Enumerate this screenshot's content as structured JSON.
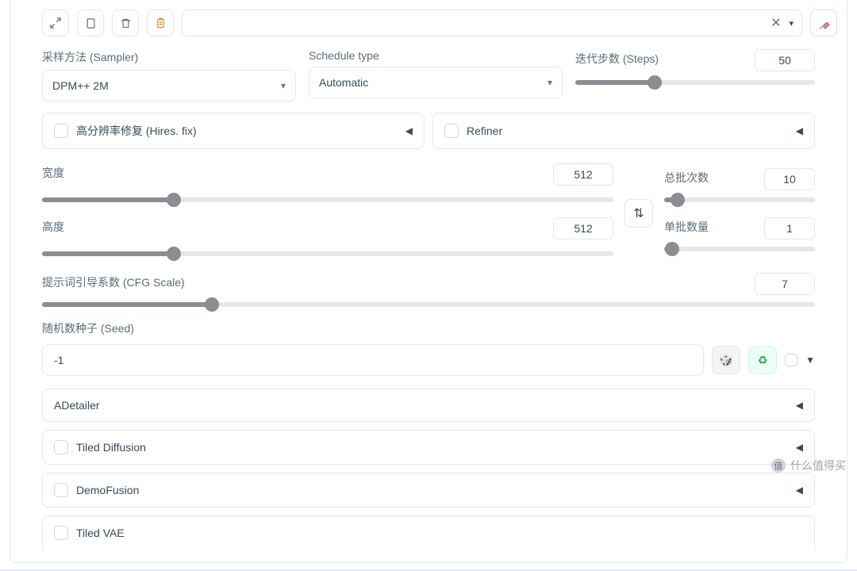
{
  "toolbar": {
    "icons": {
      "expand": "expand-icon",
      "copy": "copy-icon",
      "trash": "trash-icon",
      "clipboard": "clipboard-icon",
      "brush": "brush-icon"
    },
    "close_x": "✕",
    "caret": "▾"
  },
  "sampler": {
    "label": "采样方法 (Sampler)",
    "value": "DPM++ 2M"
  },
  "schedule": {
    "label": "Schedule type",
    "value": "Automatic"
  },
  "steps": {
    "label": "迭代步数 (Steps)",
    "value": "50",
    "fill_pct": 33
  },
  "hires": {
    "label": "高分辨率修复 (Hires. fix)"
  },
  "refiner": {
    "label": "Refiner"
  },
  "width": {
    "label": "宽度",
    "value": "512",
    "fill_pct": 23
  },
  "height": {
    "label": "高度",
    "value": "512",
    "fill_pct": 23
  },
  "swap_glyph": "⇅",
  "batch_count": {
    "label": "总批次数",
    "value": "10",
    "fill_pct": 9
  },
  "batch_size": {
    "label": "单批数量",
    "value": "1",
    "fill_pct": 5
  },
  "cfg": {
    "label": "提示词引导系数 (CFG Scale)",
    "value": "7",
    "fill_pct": 22
  },
  "seed": {
    "label": "随机数种子 (Seed)",
    "value": "-1",
    "dice_glyph": "🎲",
    "recycle_glyph": "♻",
    "caret": "▼"
  },
  "accordions": {
    "adetailer": "ADetailer",
    "tiled_diffusion": "Tiled Diffusion",
    "demofusion": "DemoFusion",
    "tiled_vae": "Tiled VAE"
  },
  "triangle_left": "◀",
  "watermark": "什么值得买"
}
